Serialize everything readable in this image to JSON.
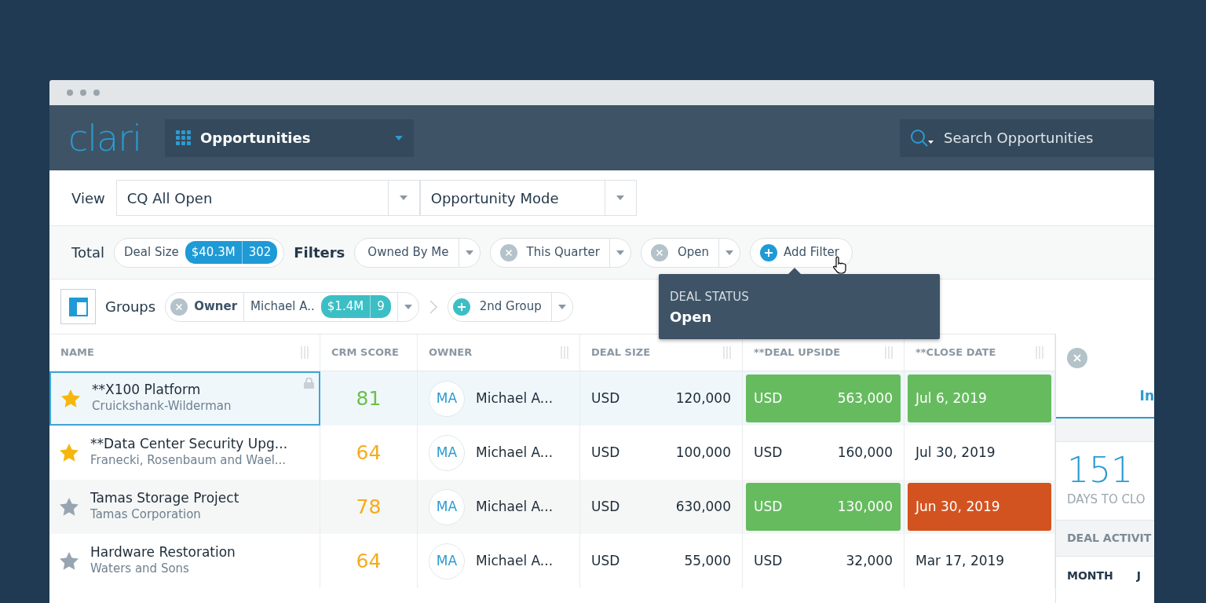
{
  "header": {
    "logo": "clari",
    "app_menu": "Opportunities",
    "search": {
      "placeholder": "Search Opportunities"
    }
  },
  "view_bar": {
    "label": "View",
    "view": "CQ All Open",
    "mode": "Opportunity Mode"
  },
  "filter_bar": {
    "total_label": "Total",
    "total_name": "Deal Size",
    "total_amount": "$40.3M",
    "total_count": "302",
    "filters_label": "Filters",
    "filters": [
      {
        "label": "Owned By Me",
        "removable": false
      },
      {
        "label": "This Quarter",
        "removable": true
      },
      {
        "label": "Open",
        "removable": true
      }
    ],
    "add_filter": "Add Filter"
  },
  "tooltip": {
    "title": "DEAL STATUS",
    "value": "Open"
  },
  "groups_bar": {
    "label": "Groups",
    "group": {
      "name": "Owner",
      "value": "Michael A..",
      "amount": "$1.4M",
      "count": "9"
    },
    "next_group": "2nd Group"
  },
  "table": {
    "columns": [
      "NAME",
      "CRM SCORE",
      "OWNER",
      "DEAL SIZE",
      "**DEAL UPSIDE",
      "**CLOSE DATE"
    ],
    "rows": [
      {
        "selected": true,
        "starred": true,
        "locked": true,
        "name": "**X100 Platform",
        "account": "Cruickshank-Wilderman",
        "score": {
          "value": "81",
          "color": "#6cc04a"
        },
        "avatar": "MA",
        "owner": "Michael A...",
        "size_currency": "USD",
        "size": "120,000",
        "upside": {
          "currency": "USD",
          "amount": "563,000",
          "kind": "good"
        },
        "close": {
          "date": "Jul 6, 2019",
          "kind": "good"
        }
      },
      {
        "selected": false,
        "starred": true,
        "locked": false,
        "name": "**Data Center Security Upg...",
        "account": "Franecki, Rosenbaum and Wael...",
        "score": {
          "value": "64",
          "color": "#f5ab1b"
        },
        "avatar": "MA",
        "owner": "Michael A...",
        "size_currency": "USD",
        "size": "100,000",
        "upside": {
          "currency": "USD",
          "amount": "160,000",
          "kind": "plain"
        },
        "close": {
          "date": "Jul 30, 2019",
          "kind": "plain"
        }
      },
      {
        "selected": false,
        "starred": false,
        "locked": false,
        "name": "Tamas Storage Project",
        "account": "Tamas Corporation",
        "score": {
          "value": "78",
          "color": "#f5ab1b"
        },
        "avatar": "MA",
        "owner": "Michael A...",
        "size_currency": "USD",
        "size": "630,000",
        "upside": {
          "currency": "USD",
          "amount": "130,000",
          "kind": "good"
        },
        "close": {
          "date": "Jun 30, 2019",
          "kind": "late"
        }
      },
      {
        "selected": false,
        "starred": false,
        "locked": false,
        "name": "Hardware Restoration",
        "account": "Waters and Sons",
        "score": {
          "value": "64",
          "color": "#f5ab1b"
        },
        "avatar": "MA",
        "owner": "Michael A...",
        "size_currency": "USD",
        "size": "55,000",
        "upside": {
          "currency": "USD",
          "amount": "32,000",
          "kind": "plain"
        },
        "close": {
          "date": "Mar 17, 2019",
          "kind": "plain"
        }
      }
    ]
  },
  "side_panel": {
    "tab": "In",
    "tab_selected": true,
    "days": "151",
    "days_label": "DAYS TO CLO",
    "section": "DEAL ACTIVIT",
    "month_label": "MONTH",
    "column_2": "J"
  }
}
